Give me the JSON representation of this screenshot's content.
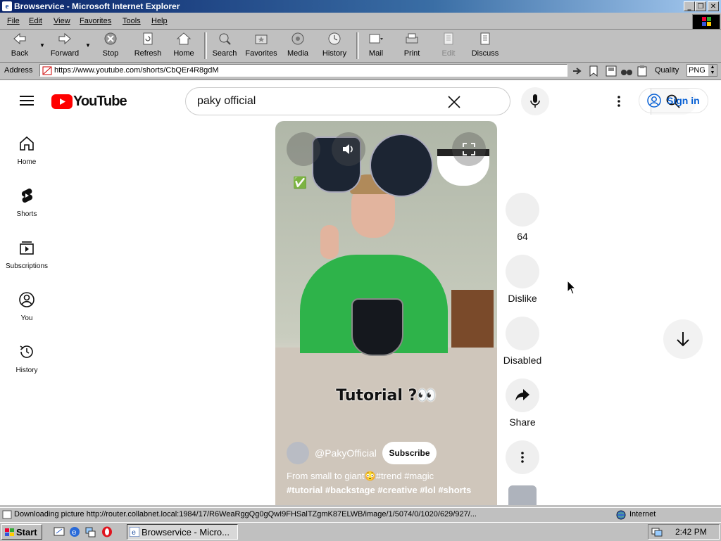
{
  "window": {
    "title": "Browservice - Microsoft Internet Explorer",
    "min_label": "_",
    "max_label": "❐",
    "close_label": "✕"
  },
  "menu": [
    "File",
    "Edit",
    "View",
    "Favorites",
    "Tools",
    "Help"
  ],
  "toolbar": {
    "back": "Back",
    "forward": "Forward",
    "stop": "Stop",
    "refresh": "Refresh",
    "home": "Home",
    "search": "Search",
    "favorites": "Favorites",
    "media": "Media",
    "history": "History",
    "mail": "Mail",
    "print": "Print",
    "edit": "Edit",
    "discuss": "Discuss"
  },
  "address": {
    "label": "Address",
    "url": "https://www.youtube.com/shorts/CbQEr4R8gdM",
    "quality_label": "Quality",
    "quality_value": "PNG"
  },
  "youtube": {
    "logo_text": "YouTube",
    "search_query": "paky official",
    "sign_in": "Sign in",
    "nav": [
      {
        "label": "Home"
      },
      {
        "label": "Shorts"
      },
      {
        "label": "Subscriptions"
      },
      {
        "label": "You"
      },
      {
        "label": "History"
      }
    ],
    "video": {
      "caption": "Tutorial ?👀",
      "channel": "@PakyOfficial",
      "subscribe": "Subscribe",
      "description_line1": "From small to giant😳#trend #magic",
      "description_line2": "#tutorial #backstage #creative #lol #shorts",
      "checkmark": "✅"
    },
    "actions": {
      "likes": "64",
      "dislike": "Dislike",
      "comments": "Disabled",
      "share": "Share"
    }
  },
  "status": {
    "text": "Downloading picture http://router.collabnet.local:1984/17/R6WeaRggQg0gQwI9FHSalTZgmK87ELWB/image/1/5074/0/1020/629/927/...",
    "zone": "Internet"
  },
  "taskbar": {
    "start": "Start",
    "item": "Browservice - Micro...",
    "clock": "2:42 PM"
  },
  "colors": {
    "yt_red": "#ff0000",
    "link_blue": "#065fd4",
    "win_blue": "#0a246a",
    "hoodie_green": "#2eb34a"
  }
}
